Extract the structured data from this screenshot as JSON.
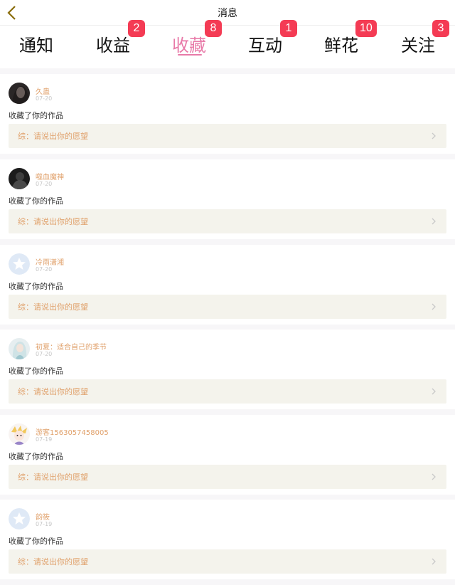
{
  "header": {
    "title": "消息"
  },
  "tabs": [
    {
      "label": "通知",
      "badge": ""
    },
    {
      "label": "收益",
      "badge": "2"
    },
    {
      "label": "收藏",
      "badge": "8",
      "active": true
    },
    {
      "label": "互动",
      "badge": "1"
    },
    {
      "label": "鲜花",
      "badge": "10"
    },
    {
      "label": "关注",
      "badge": "3"
    }
  ],
  "items": [
    {
      "name": "久蛊",
      "date": "07-20",
      "action": "收藏了你的作品",
      "work": "综：请说出你的愿望",
      "avatar": "dark-portrait"
    },
    {
      "name": "噬血魔神",
      "date": "07-20",
      "action": "收藏了你的作品",
      "work": "综：请说出你的愿望",
      "avatar": "dark-figure"
    },
    {
      "name": "冷雨潇湘",
      "date": "07-20",
      "action": "收藏了你的作品",
      "work": "综：请说出你的愿望",
      "avatar": "default-star"
    },
    {
      "name": "初夏：适合自己的季节",
      "date": "07-20",
      "action": "收藏了你的作品",
      "work": "综：请说出你的愿望",
      "avatar": "anime-girl"
    },
    {
      "name": "游客1563057458005",
      "date": "07-19",
      "action": "收藏了你的作品",
      "work": "综：请说出你的愿望",
      "avatar": "cartoon-character"
    },
    {
      "name": "韵筱",
      "date": "07-19",
      "action": "收藏了你的作品",
      "work": "综：请说出你的愿望",
      "avatar": "default-star"
    }
  ],
  "colors": {
    "accent": "#e87aa8",
    "badge": "#f43b54",
    "name": "#e0a06a",
    "work_bg": "#f4f3ec"
  }
}
